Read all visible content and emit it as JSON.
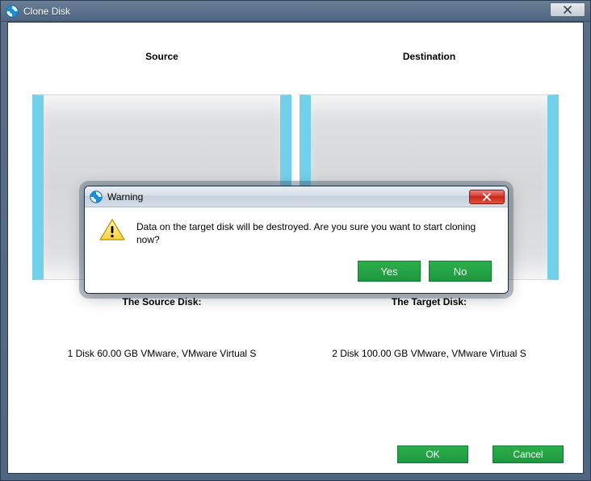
{
  "window": {
    "title": "Clone Disk"
  },
  "headers": {
    "source": "Source",
    "destination": "Destination"
  },
  "labels": {
    "source_disk": "The Source Disk:",
    "target_disk": "The Target Disk:"
  },
  "disks": {
    "source": "1 Disk 60.00 GB VMware,  VMware Virtual S",
    "target": "2 Disk 100.00 GB VMware,  VMware Virtual S"
  },
  "buttons": {
    "ok": "OK",
    "cancel": "Cancel"
  },
  "modal": {
    "title": "Warning",
    "message": "Data on the target disk will be destroyed. Are you sure you want to start cloning now?",
    "yes": "Yes",
    "no": "No"
  }
}
